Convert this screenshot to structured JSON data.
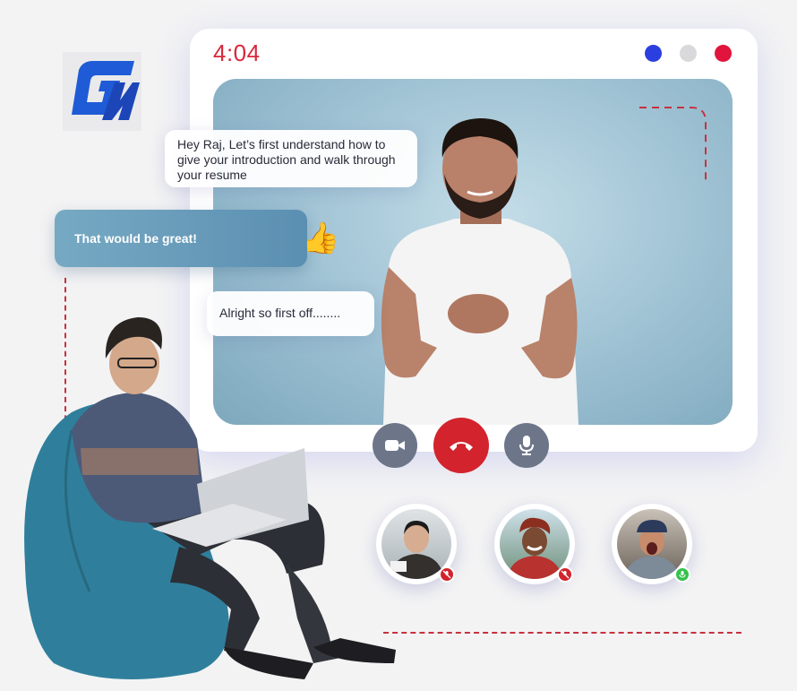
{
  "call": {
    "timer": "4:04",
    "window_dots": [
      {
        "name": "blue-dot",
        "color": "#2b3fe0"
      },
      {
        "name": "gray-dot",
        "color": "#d9d9db"
      },
      {
        "name": "red-dot",
        "color": "#e0143c"
      }
    ]
  },
  "chat": {
    "host_message_1": "Hey Raj, Let’s first understand how to give your introduction and walk through your resume",
    "user_message": "That would be great!",
    "user_emoji": "👍",
    "host_message_2": "Alright so first off........"
  },
  "controls": [
    {
      "name": "video-camera-button",
      "icon": "video-camera-icon"
    },
    {
      "name": "end-call-button",
      "icon": "phone-hangup-icon"
    },
    {
      "name": "microphone-button",
      "icon": "microphone-icon"
    }
  ],
  "participants": [
    {
      "name": "participant-1",
      "mic": "muted",
      "status_color": "#d3232d"
    },
    {
      "name": "participant-2",
      "mic": "muted",
      "status_color": "#d3232d"
    },
    {
      "name": "participant-3",
      "mic": "on",
      "status_color": "#35c24c"
    }
  ],
  "colors": {
    "accent_red": "#d3232d",
    "control_gray": "#6d7689",
    "user_bubble": "#6a9dbb"
  }
}
